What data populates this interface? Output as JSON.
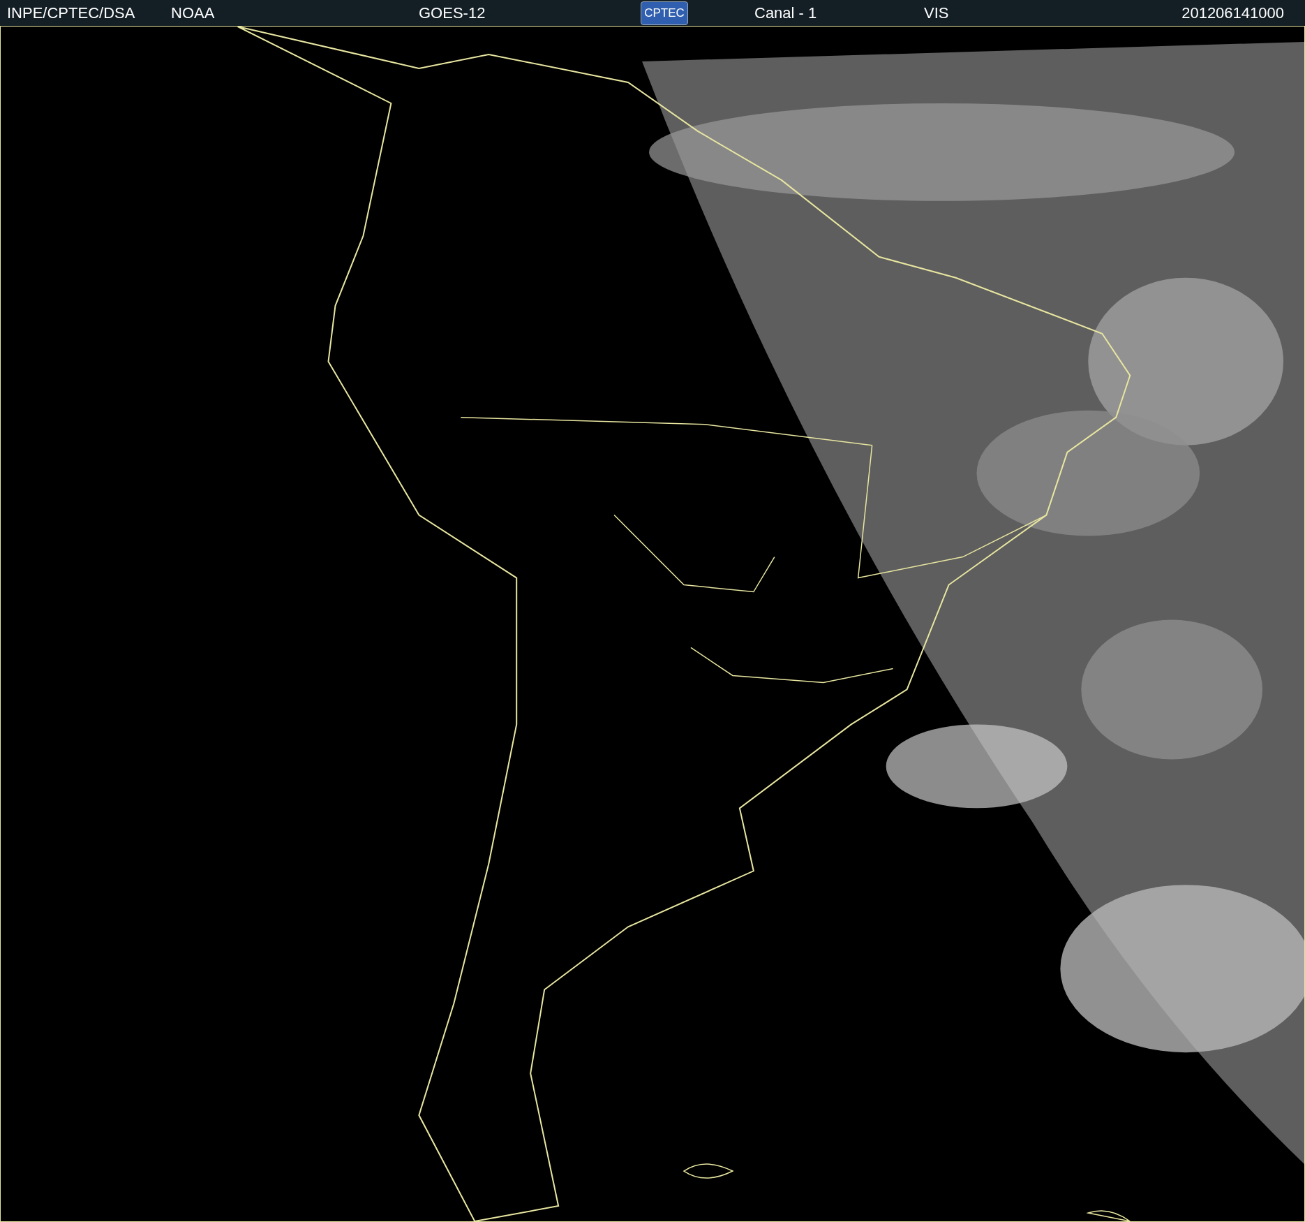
{
  "header": {
    "source": "INPE/CPTEC/DSA",
    "agency": "NOAA",
    "satellite": "GOES-12",
    "logo": "CPTEC",
    "channel": "Canal - 1",
    "band": "VIS",
    "timestamp": "201206141000"
  }
}
